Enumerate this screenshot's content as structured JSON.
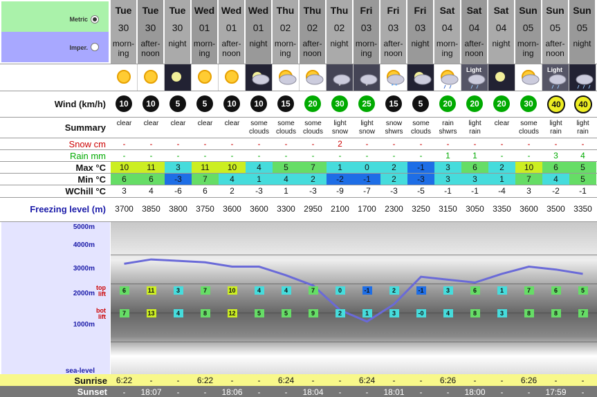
{
  "units": {
    "metric_label": "Metric",
    "imperial_label": "Imper."
  },
  "columns": [
    {
      "day": "Tue",
      "date": "30",
      "period": "morn-\ning",
      "icon": "sun-icon",
      "wind": "10",
      "wind_color": "black",
      "summary": "clear",
      "snow": "-",
      "rain": "-",
      "max": "10",
      "min": "6",
      "wchill": "3",
      "freezing": "3700",
      "top_lift": "6",
      "bot_lift": "7",
      "sunrise": "6:22",
      "sunset": "-"
    },
    {
      "day": "Tue",
      "date": "30",
      "period": "after-\nnoon",
      "icon": "sun-icon",
      "wind": "10",
      "wind_color": "black",
      "summary": "clear",
      "snow": "-",
      "rain": "-",
      "max": "11",
      "min": "6",
      "wchill": "4",
      "freezing": "3850",
      "top_lift": "11",
      "bot_lift": "13",
      "sunrise": "-",
      "sunset": "18:07"
    },
    {
      "day": "Tue",
      "date": "30",
      "period": "night",
      "icon": "moon-icon",
      "wind": "5",
      "wind_color": "black",
      "summary": "clear",
      "snow": "-",
      "rain": "-",
      "max": "3",
      "min": "-3",
      "wchill": "-6",
      "freezing": "3800",
      "top_lift": "3",
      "bot_lift": "4",
      "sunrise": "-",
      "sunset": "-"
    },
    {
      "day": "Wed",
      "date": "01",
      "period": "morn-\ning",
      "icon": "sun-icon",
      "wind": "5",
      "wind_color": "black",
      "summary": "clear",
      "snow": "-",
      "rain": "-",
      "max": "11",
      "min": "7",
      "wchill": "6",
      "freezing": "3750",
      "top_lift": "7",
      "bot_lift": "8",
      "sunrise": "6:22",
      "sunset": "-"
    },
    {
      "day": "Wed",
      "date": "01",
      "period": "after-\nnoon",
      "icon": "sun-icon",
      "wind": "10",
      "wind_color": "black",
      "summary": "clear",
      "snow": "-",
      "rain": "-",
      "max": "10",
      "min": "4",
      "wchill": "2",
      "freezing": "3600",
      "top_lift": "10",
      "bot_lift": "12",
      "sunrise": "-",
      "sunset": "18:06"
    },
    {
      "day": "Wed",
      "date": "01",
      "period": "night",
      "icon": "moon-cloud-icon",
      "wind": "10",
      "wind_color": "black",
      "summary": "some\nclouds",
      "snow": "-",
      "rain": "-",
      "max": "4",
      "min": "1",
      "wchill": "-3",
      "freezing": "3600",
      "top_lift": "4",
      "bot_lift": "5",
      "sunrise": "-",
      "sunset": "-"
    },
    {
      "day": "Thu",
      "date": "02",
      "period": "morn-\ning",
      "icon": "sun-cloud-icon",
      "wind": "15",
      "wind_color": "black",
      "summary": "some\nclouds",
      "snow": "-",
      "rain": "-",
      "max": "5",
      "min": "4",
      "wchill": "1",
      "freezing": "3300",
      "top_lift": "4",
      "bot_lift": "5",
      "sunrise": "6:24",
      "sunset": "-"
    },
    {
      "day": "Thu",
      "date": "02",
      "period": "after-\nnoon",
      "icon": "sun-cloud-icon",
      "wind": "20",
      "wind_color": "green",
      "summary": "some\nclouds",
      "snow": "-",
      "rain": "-",
      "max": "7",
      "min": "2",
      "wchill": "-3",
      "freezing": "2950",
      "top_lift": "7",
      "bot_lift": "9",
      "sunrise": "-",
      "sunset": "18:04"
    },
    {
      "day": "Thu",
      "date": "02",
      "period": "night",
      "icon": "snow-cloud-icon",
      "wind": "30",
      "wind_color": "green",
      "summary": "light\nsnow",
      "snow": "2",
      "rain": "-",
      "max": "1",
      "min": "-2",
      "wchill": "-9",
      "freezing": "2100",
      "top_lift": "0",
      "bot_lift": "2",
      "sunrise": "-",
      "sunset": "-"
    },
    {
      "day": "Fri",
      "date": "03",
      "period": "morn-\ning",
      "icon": "snow-cloud-icon",
      "wind": "25",
      "wind_color": "green",
      "summary": "light\nsnow",
      "snow": "-",
      "rain": "-",
      "max": "0",
      "min": "-1",
      "wchill": "-7",
      "freezing": "1700",
      "top_lift": "-1",
      "bot_lift": "1",
      "sunrise": "6:24",
      "sunset": "-"
    },
    {
      "day": "Fri",
      "date": "03",
      "period": "after-\nnoon",
      "icon": "sun-snow-icon",
      "wind": "15",
      "wind_color": "black",
      "summary": "snow\nshwrs",
      "snow": "-",
      "rain": "-",
      "max": "2",
      "min": "2",
      "wchill": "-3",
      "freezing": "2300",
      "top_lift": "2",
      "bot_lift": "3",
      "sunrise": "-",
      "sunset": "18:01"
    },
    {
      "day": "Fri",
      "date": "03",
      "period": "night",
      "icon": "moon-cloud-icon",
      "wind": "5",
      "wind_color": "black",
      "summary": "some\nclouds",
      "snow": "-",
      "rain": "-",
      "max": "-1",
      "min": "-3",
      "wchill": "-5",
      "freezing": "3250",
      "top_lift": "-1",
      "bot_lift": "-0",
      "sunrise": "-",
      "sunset": "-"
    },
    {
      "day": "Sat",
      "date": "04",
      "period": "morn-\ning",
      "icon": "rain-cloud-icon",
      "wind": "20",
      "wind_color": "green",
      "summary": "rain\nshwrs",
      "snow": "-",
      "rain": "1",
      "max": "3",
      "min": "3",
      "wchill": "-1",
      "freezing": "3150",
      "top_lift": "3",
      "bot_lift": "4",
      "sunrise": "6:26",
      "sunset": "-"
    },
    {
      "day": "Sat",
      "date": "04",
      "period": "after-\nnoon",
      "icon": "light-rain-icon",
      "icon_text": "Light",
      "wind": "20",
      "wind_color": "green",
      "summary": "light\nrain",
      "snow": "-",
      "rain": "1",
      "max": "6",
      "min": "3",
      "wchill": "-1",
      "freezing": "3050",
      "top_lift": "6",
      "bot_lift": "8",
      "sunrise": "-",
      "sunset": "18:00"
    },
    {
      "day": "Sat",
      "date": "04",
      "period": "night",
      "icon": "moon-icon",
      "wind": "20",
      "wind_color": "green",
      "summary": "clear",
      "snow": "-",
      "rain": "-",
      "max": "2",
      "min": "1",
      "wchill": "-4",
      "freezing": "3350",
      "top_lift": "1",
      "bot_lift": "3",
      "sunrise": "-",
      "sunset": "-"
    },
    {
      "day": "Sun",
      "date": "05",
      "period": "morn-\ning",
      "icon": "sun-cloud-icon",
      "wind": "30",
      "wind_color": "green",
      "summary": "some\nclouds",
      "snow": "-",
      "rain": "-",
      "max": "10",
      "min": "7",
      "wchill": "3",
      "freezing": "3600",
      "top_lift": "7",
      "bot_lift": "8",
      "sunrise": "6:26",
      "sunset": "-"
    },
    {
      "day": "Sun",
      "date": "05",
      "period": "after-\nnoon",
      "icon": "light-rain-icon",
      "icon_text": "Light",
      "wind": "40",
      "wind_color": "yellow",
      "summary": "light\nrain",
      "snow": "-",
      "rain": "3",
      "max": "6",
      "min": "4",
      "wchill": "-2",
      "freezing": "3500",
      "top_lift": "6",
      "bot_lift": "8",
      "sunrise": "-",
      "sunset": "17:59"
    },
    {
      "day": "Sun",
      "date": "05",
      "period": "night",
      "icon": "rain-night-icon",
      "wind": "40",
      "wind_color": "yellow",
      "summary": "light\nrain",
      "snow": "-",
      "rain": "4",
      "max": "5",
      "min": "5",
      "wchill": "-1",
      "freezing": "3350",
      "top_lift": "5",
      "bot_lift": "7",
      "sunrise": "-",
      "sunset": "-"
    }
  ],
  "row_labels": {
    "wind": "Wind (km/h)",
    "summary": "Summary",
    "snow": "Snow cm",
    "rain": "Rain mm",
    "max": "Max °C",
    "min": "Min °C",
    "wchill": "WChill °C",
    "freezing": "Freezing level (m)",
    "sunrise": "Sunrise",
    "sunset": "Sunset"
  },
  "altitude_labels": {
    "a5000": "5000m",
    "a4000": "4000m",
    "a3000": "3000m",
    "a2000": "2000m",
    "a1000": "1000m",
    "sea": "sea-level",
    "top_lift": "top\nlift",
    "bot_lift": "bot\nlift"
  },
  "colors": {
    "metric_bg": "#aaf2aa",
    "imperial_bg": "#a8a8ff",
    "freezing_line": "#6a6ad8",
    "snow_label": "#c00",
    "rain_label": "#0a0",
    "freezing_label": "#1a1aa8"
  }
}
